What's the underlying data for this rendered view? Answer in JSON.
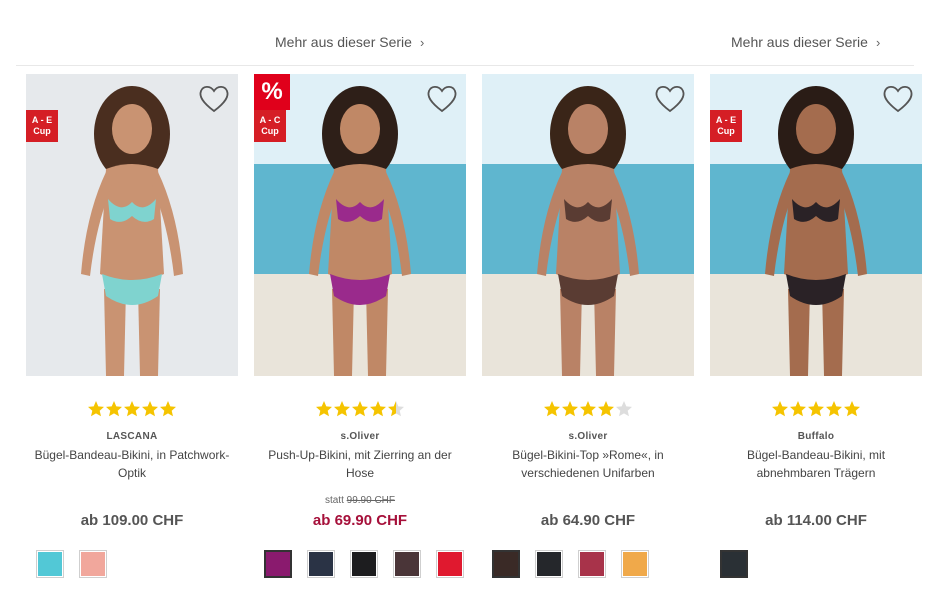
{
  "series_links": [
    {
      "label": "Mehr aus dieser Serie",
      "chevron": "›"
    },
    {
      "label": "Mehr aus dieser Serie",
      "chevron": "›"
    }
  ],
  "products": [
    {
      "badge_cup_line1": "A - E",
      "badge_cup_line2": "Cup",
      "has_sale_badge": false,
      "rating": 5,
      "brand": "LASCANA",
      "name": "Bügel-Bandeau-Bikini, in Patchwork-Optik",
      "price": "ab 109.00 CHF",
      "swatches": [
        "#52c8d6",
        "#f1a79c"
      ],
      "photo_colors": {
        "bg": "#e6e9ec",
        "suit": "#7fd3cf",
        "skin": "#c99372",
        "hair": "#4a2e1f"
      }
    },
    {
      "sale_badge": "%",
      "badge_cup_line1": "A - C",
      "badge_cup_line2": "Cup",
      "rating": 4.5,
      "brand": "s.Oliver",
      "name": "Push-Up-Bikini, mit Zierring an der Hose",
      "old_price_prefix": "statt",
      "old_price": "99.90 CHF",
      "price": "ab 69.90 CHF",
      "swatches": [
        "#8a1a6e",
        "#2a3345",
        "#1d1d1f",
        "#4a3538",
        "#e0192f"
      ],
      "photo_colors": {
        "bg": "#8fc4d8",
        "suit": "#9a2a8c",
        "skin": "#c08866",
        "hair": "#2e1f18"
      }
    },
    {
      "rating": 4,
      "brand": "s.Oliver",
      "name": "Bügel-Bikini-Top »Rome«, in verschiedenen Unifarben",
      "price": "ab 64.90 CHF",
      "swatches": [
        "#3a2a26",
        "#25272b",
        "#a8334a",
        "#f0a94a"
      ],
      "photo_colors": {
        "bg": "#94cde0",
        "suit": "#5a3c33",
        "skin": "#b98266",
        "hair": "#3a2518"
      }
    },
    {
      "badge_cup_line1": "A - E",
      "badge_cup_line2": "Cup",
      "rating": 5,
      "brand": "Buffalo",
      "name": "Bügel-Bandeau-Bikini, mit abnehmbaren Trägern",
      "price": "ab 114.00 CHF",
      "swatches": [
        "#2a3035"
      ],
      "photo_colors": {
        "bg": "#a6d4e3",
        "suit": "#2a2226",
        "skin": "#a46c4e",
        "hair": "#2a1c16"
      }
    }
  ],
  "icons": {
    "heart": "heart-outline-icon",
    "star": "star-icon",
    "chevron": "chevron-right-icon"
  },
  "colors": {
    "star": "#f5c400",
    "star_empty": "#dddddd",
    "sale_price": "#a6103a",
    "badge_red": "#d51e25"
  }
}
